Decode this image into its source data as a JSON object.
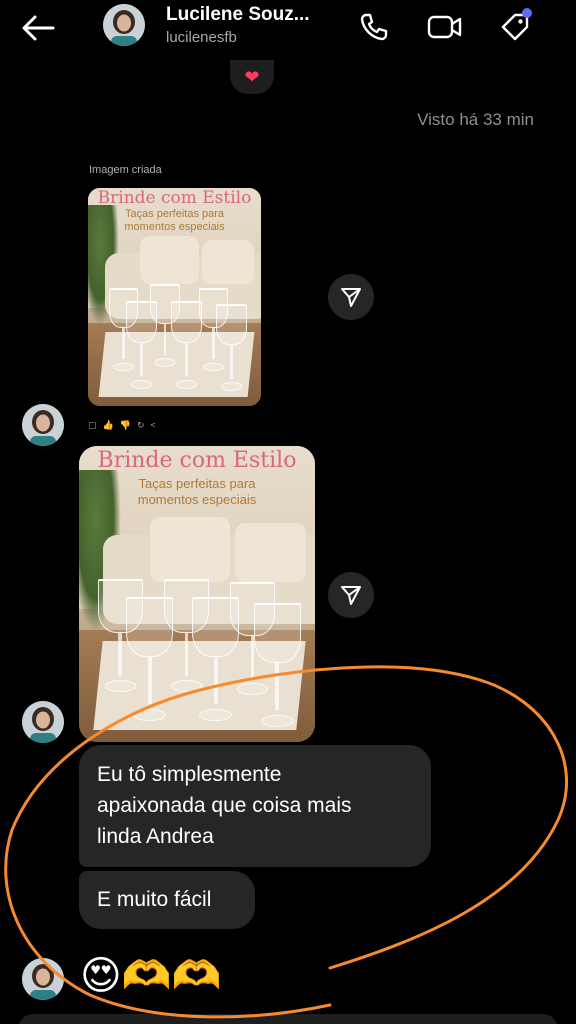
{
  "header": {
    "name": "Lucilene Souz...",
    "username": "lucilenesfb",
    "accent_dot_color": "#5b6cff"
  },
  "reaction": {
    "emoji": "❤"
  },
  "status": {
    "seen": "Visto há 33 min"
  },
  "generated_label": "Imagem criada",
  "ad_image": {
    "title": "Brinde com Estilo",
    "subtitle_line1": "Taças perfeitas para",
    "subtitle_line2": "momentos especiais"
  },
  "messages": [
    {
      "text_line1": "Eu tô simplesmente",
      "text_line2": "apaixonada que coisa mais",
      "text_line3": "linda Andrea"
    },
    {
      "text": "E muito fácil"
    }
  ],
  "emoji_message": "😍🫶🫶",
  "icons": {
    "back": "arrow-left-icon",
    "call": "phone-icon",
    "video": "video-camera-icon",
    "tag": "tag-icon",
    "share": "send-icon"
  },
  "colors": {
    "bubble": "#262626",
    "annotation": "#f58a2e",
    "ad_title": "#d9687a"
  }
}
